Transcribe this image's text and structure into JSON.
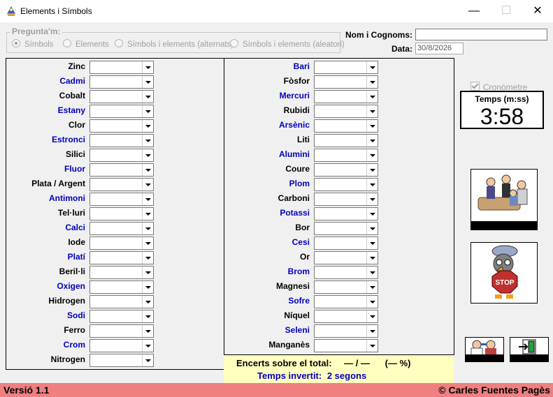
{
  "window": {
    "title": "Elements i Símbols",
    "minimize": "—",
    "maximize": "☐",
    "close": "✕"
  },
  "question_group": {
    "legend": "Pregunta'm:",
    "options": [
      "Símbols",
      "Elements",
      "Símbols i elements (alternats)",
      "Símbols i elements (aleatori)"
    ],
    "selected": "Símbols"
  },
  "form": {
    "name_label": "Nom i Cognoms:",
    "name_value": "",
    "date_label": "Data:",
    "date_value": "30/8/2026"
  },
  "left_elements": [
    {
      "label": "Zinc",
      "color": "black"
    },
    {
      "label": "Cadmi",
      "color": "blue"
    },
    {
      "label": "Cobalt",
      "color": "black"
    },
    {
      "label": "Estany",
      "color": "blue"
    },
    {
      "label": "Clor",
      "color": "black"
    },
    {
      "label": "Estronci",
      "color": "blue"
    },
    {
      "label": "Silici",
      "color": "black"
    },
    {
      "label": "Fluor",
      "color": "blue"
    },
    {
      "label": "Plata / Argent",
      "color": "black"
    },
    {
      "label": "Antimoni",
      "color": "blue"
    },
    {
      "label": "Tel·luri",
      "color": "black"
    },
    {
      "label": "Calci",
      "color": "blue"
    },
    {
      "label": "Iode",
      "color": "black"
    },
    {
      "label": "Platí",
      "color": "blue"
    },
    {
      "label": "Beril·li",
      "color": "black"
    },
    {
      "label": "Oxigen",
      "color": "blue"
    },
    {
      "label": "Hidrogen",
      "color": "black"
    },
    {
      "label": "Sodi",
      "color": "blue"
    },
    {
      "label": "Ferro",
      "color": "black"
    },
    {
      "label": "Crom",
      "color": "blue"
    },
    {
      "label": "Nitrogen",
      "color": "black"
    }
  ],
  "right_elements": [
    {
      "label": "Bari",
      "color": "blue"
    },
    {
      "label": "Fòsfor",
      "color": "black"
    },
    {
      "label": "Mercuri",
      "color": "blue"
    },
    {
      "label": "Rubidi",
      "color": "black"
    },
    {
      "label": "Arsènic",
      "color": "blue"
    },
    {
      "label": "Liti",
      "color": "black"
    },
    {
      "label": "Alumini",
      "color": "blue"
    },
    {
      "label": "Coure",
      "color": "black"
    },
    {
      "label": "Plom",
      "color": "blue"
    },
    {
      "label": "Carboni",
      "color": "black"
    },
    {
      "label": "Potassi",
      "color": "blue"
    },
    {
      "label": "Bor",
      "color": "black"
    },
    {
      "label": "Cesi",
      "color": "blue"
    },
    {
      "label": "Or",
      "color": "black"
    },
    {
      "label": "Brom",
      "color": "blue"
    },
    {
      "label": "Magnesi",
      "color": "black"
    },
    {
      "label": "Sofre",
      "color": "blue"
    },
    {
      "label": "Níquel",
      "color": "black"
    },
    {
      "label": "Seleni",
      "color": "blue"
    },
    {
      "label": "Manganès",
      "color": "black"
    }
  ],
  "results": {
    "hits_label": "Encerts sobre el total:",
    "hits_value": "— / —",
    "percent_value": "(— %)",
    "time_label": "Temps invertit:",
    "time_value": "2 segons"
  },
  "timer": {
    "checkbox_label": "Cronòmetre",
    "checked": true,
    "label": "Temps (m:ss)",
    "value": "3:58"
  },
  "buttons": {
    "correct_icon": "people-meeting-icon",
    "stop_icon": "stop-bird-icon",
    "help_icon": "doctor-icon",
    "exit_icon": "exit-door-icon"
  },
  "status": {
    "version": "Versió 1.1",
    "author": "© Carles Fuentes Pagès"
  },
  "colors": {
    "blue_label": "#0000c0",
    "status_bar": "#f08080",
    "result_bg": "#ffffc0"
  }
}
